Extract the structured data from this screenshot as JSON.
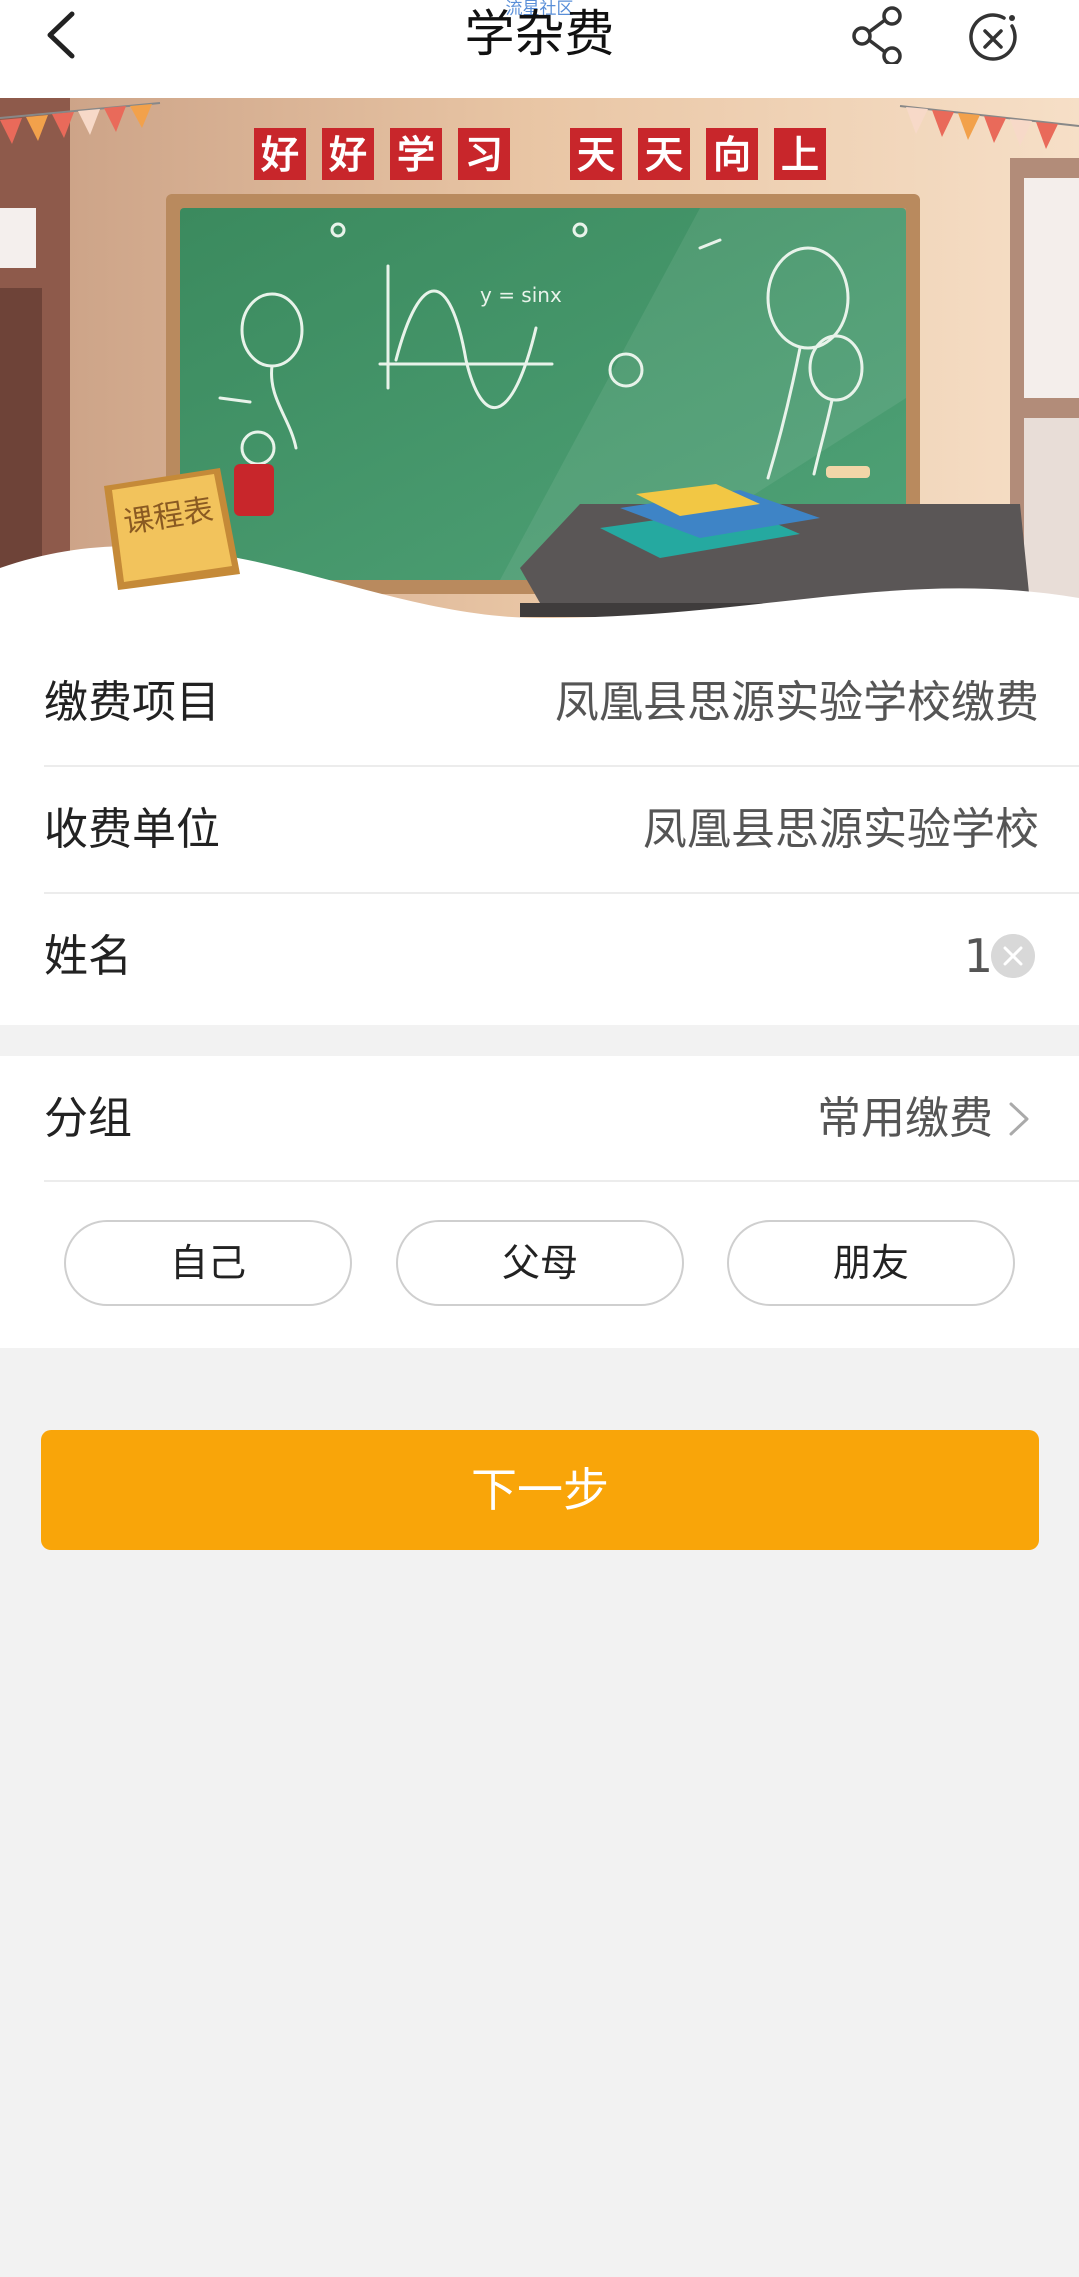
{
  "header": {
    "watermark": "流星社区",
    "title": "学杂费"
  },
  "banner": {
    "slogan_left": [
      "好",
      "好",
      "学",
      "习"
    ],
    "slogan_right": [
      "天",
      "天",
      "向",
      "上"
    ],
    "board_formula": "y = sinx",
    "sign_text": "课程表"
  },
  "form": {
    "item_label": "缴费项目",
    "item_value": "凤凰县思源实验学校缴费",
    "payee_label": "收费单位",
    "payee_value": "凤凰县思源实验学校",
    "name_label": "姓名",
    "name_value": "1"
  },
  "group": {
    "label": "分组",
    "value": "常用缴费",
    "chips": [
      "自己",
      "父母",
      "朋友"
    ]
  },
  "actions": {
    "next_label": "下一步"
  },
  "colors": {
    "accent": "#f9a509",
    "board": "#3e8a5f",
    "slogan": "#c8262b"
  }
}
